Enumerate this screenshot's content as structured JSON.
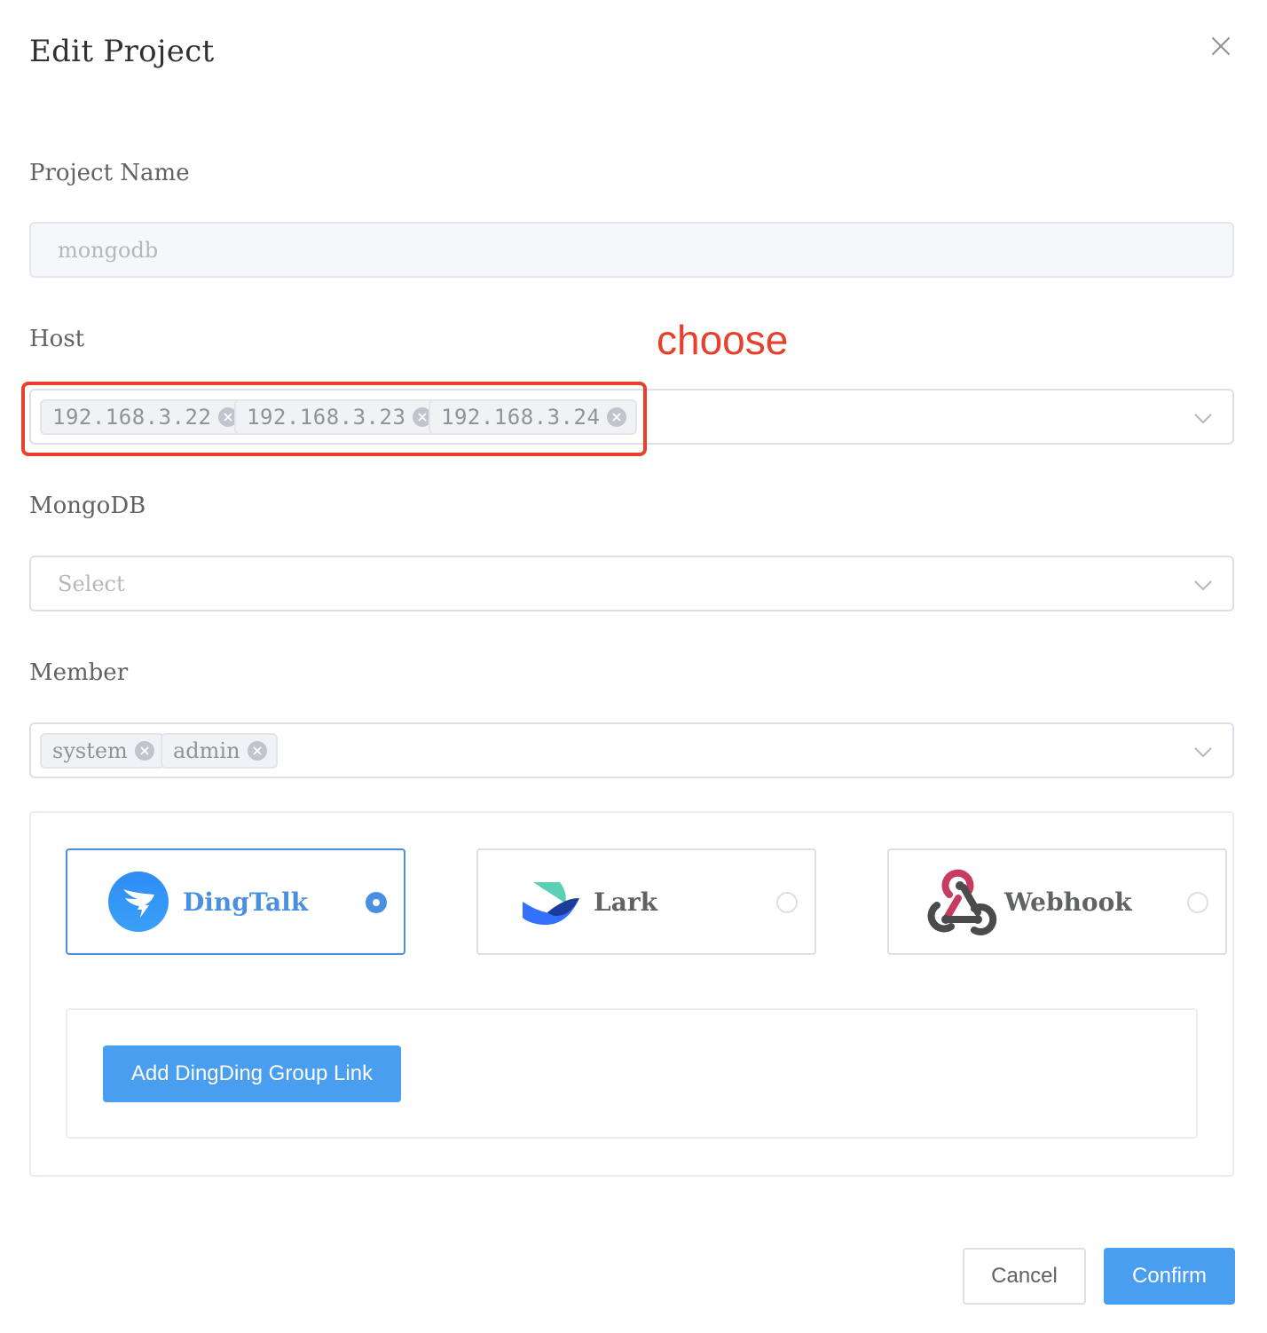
{
  "dialog": {
    "title": "Edit Project"
  },
  "fields": {
    "project_name": {
      "label": "Project Name",
      "value": "mongodb"
    },
    "host": {
      "label": "Host",
      "tags": [
        "192.168.3.22",
        "192.168.3.23",
        "192.168.3.24"
      ]
    },
    "mongodb": {
      "label": "MongoDB",
      "placeholder": "Select"
    },
    "member": {
      "label": "Member",
      "tags": [
        "system",
        "admin"
      ]
    }
  },
  "annotation": {
    "text": "choose",
    "color": "#e8402c"
  },
  "notify": {
    "options": [
      {
        "label": "DingTalk",
        "icon": "dingtalk-logo-icon",
        "selected": true
      },
      {
        "label": "Lark",
        "icon": "lark-logo-icon",
        "selected": false
      },
      {
        "label": "Webhook",
        "icon": "webhook-logo-icon",
        "selected": false
      }
    ],
    "add_link_label": "Add DingDing Group Link"
  },
  "footer": {
    "cancel_label": "Cancel",
    "confirm_label": "Confirm"
  },
  "colors": {
    "accent": "#4a90e2",
    "primary_button": "#4a9ef0",
    "annotation": "#e8402c"
  }
}
